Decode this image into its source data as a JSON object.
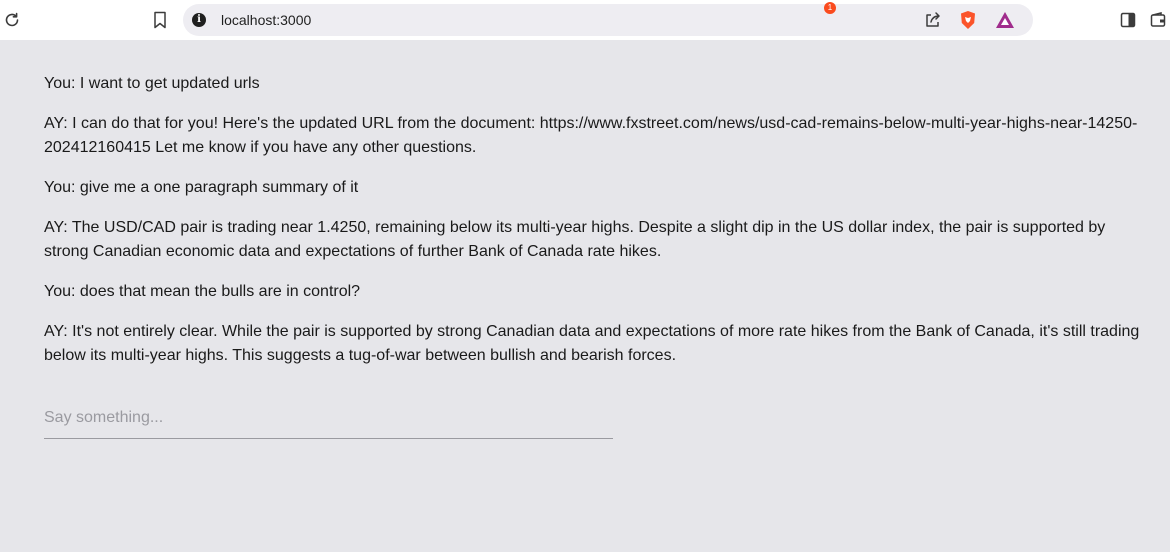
{
  "browser": {
    "url": "localhost:3000",
    "rewards_badge": "1",
    "icons": [
      "reload-icon",
      "bookmark-icon",
      "site-info-icon",
      "share-icon",
      "brave-shields-icon",
      "brave-rewards-icon",
      "sidebar-toggle-icon",
      "wallet-icon"
    ],
    "colors": {
      "shield": "#fb542b",
      "rewards": "#a02c8c",
      "badge": "#fa4b1e"
    }
  },
  "chat": {
    "messages": [
      "You: I want to get updated urls",
      "AY: I can do that for you! Here's the updated URL from the document: https://www.fxstreet.com/news/usd-cad-remains-below-multi-year-highs-near-14250-202412160415 Let me know if you have any other questions.",
      "You: give me a one paragraph summary of it",
      "AY: The USD/CAD pair is trading near 1.4250, remaining below its multi-year highs. Despite a slight dip in the US dollar index, the pair is supported by strong Canadian economic data and expectations of further Bank of Canada rate hikes.",
      "You: does that mean the bulls are in control?",
      "AY: It's not entirely clear. While the pair is supported by strong Canadian data and expectations of more rate hikes from the Bank of Canada, it's still trading below its multi-year highs. This suggests a tug-of-war between bullish and bearish forces."
    ],
    "input": {
      "placeholder": "Say something...",
      "value": ""
    }
  }
}
